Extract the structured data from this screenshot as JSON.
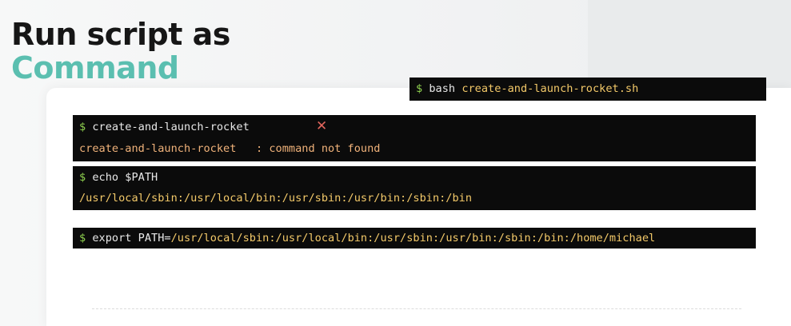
{
  "title": {
    "line1": "Run script as",
    "line2": "Command"
  },
  "prompt_symbol": "$",
  "term_bash": {
    "cmd": "bash",
    "arg": "create-and-launch-rocket.sh"
  },
  "term_create": {
    "cmd": "create-and-launch-rocket",
    "error_icon": "close-icon",
    "error_mark": "✕",
    "error_name": "create-and-launch-rocket",
    "error_msg": "   : command not found"
  },
  "term_echo": {
    "cmd": "echo $PATH",
    "output": "/usr/local/sbin:/usr/local/bin:/usr/sbin:/usr/bin:/sbin:/bin"
  },
  "term_export": {
    "cmd": "export PATH=",
    "value": "/usr/local/sbin:/usr/local/bin:/usr/sbin:/usr/bin:/sbin:/bin:/home/michael"
  },
  "colors": {
    "accent_teal": "#5bbfb0",
    "prompt_green": "#8fd14f",
    "path_yellow": "#f3c969",
    "error_orange": "#f0b27a",
    "error_red": "#e0655c"
  }
}
